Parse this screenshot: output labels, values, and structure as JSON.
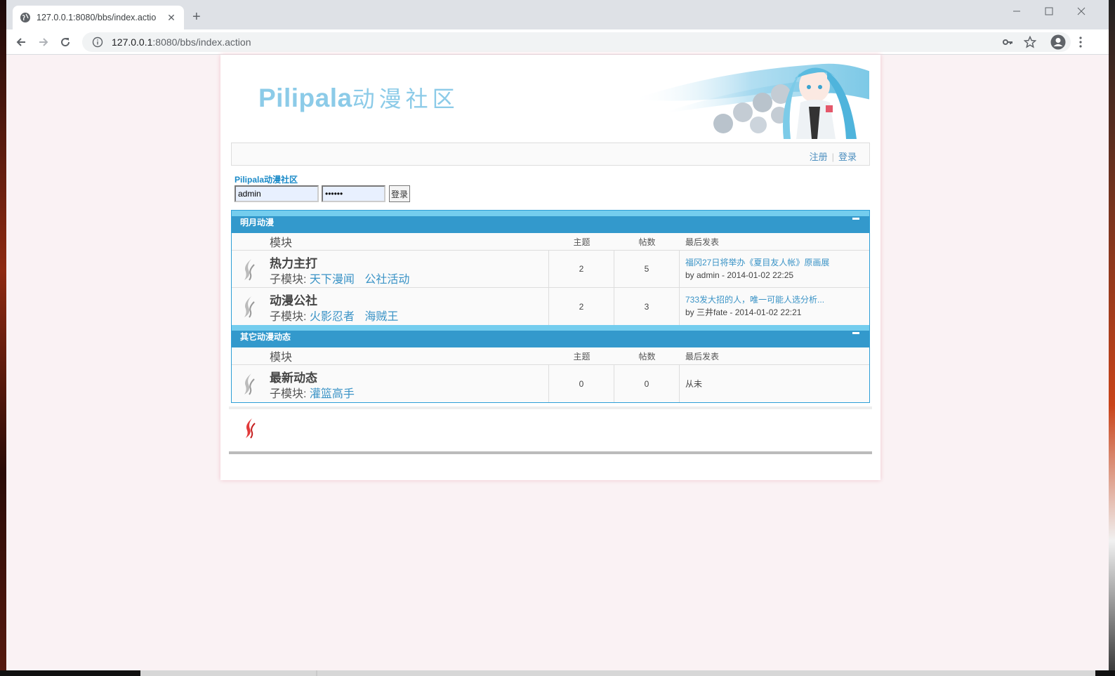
{
  "browser": {
    "tab_title": "127.0.0.1:8080/bbs/index.actio",
    "url_host": "127.0.0.1",
    "url_path": ":8080/bbs/index.action"
  },
  "header": {
    "logo_latin": "Pilipala",
    "logo_cjk": "动漫社区",
    "nav": {
      "register": "注册",
      "login": "登录"
    }
  },
  "login": {
    "site_name": "Pilipala动漫社区",
    "username": "admin",
    "password": "••••••",
    "submit": "登录"
  },
  "columns": {
    "module": "模块",
    "topics": "主题",
    "posts": "帖数",
    "last": "最后发表"
  },
  "categories": [
    {
      "title": "明月动漫",
      "boards": [
        {
          "name": "热力主打",
          "sub_label": "子模块:",
          "subs": [
            "天下漫闻",
            "公社活动"
          ],
          "topics": "2",
          "posts": "5",
          "last_title": "福冈27日将举办《夏目友人帐》原画展",
          "last_by": "by admin - 2014-01-02 22:25"
        },
        {
          "name": "动漫公社",
          "sub_label": "子模块:",
          "subs": [
            "火影忍者",
            "海贼王"
          ],
          "topics": "2",
          "posts": "3",
          "last_title": "733发大招的人，唯一可能人选分析...",
          "last_by": "by 三井fate - 2014-01-02 22:21"
        }
      ]
    },
    {
      "title": "其它动漫动态",
      "boards": [
        {
          "name": "最新动态",
          "sub_label": "子模块:",
          "subs": [
            "灌篮高手"
          ],
          "topics": "0",
          "posts": "0",
          "last_none": "从未"
        }
      ]
    }
  ],
  "colors": {
    "accent": "#3399cc",
    "accent_light": "#74cdee",
    "link": "#3a93c6",
    "page_bg": "#faf2f4"
  }
}
